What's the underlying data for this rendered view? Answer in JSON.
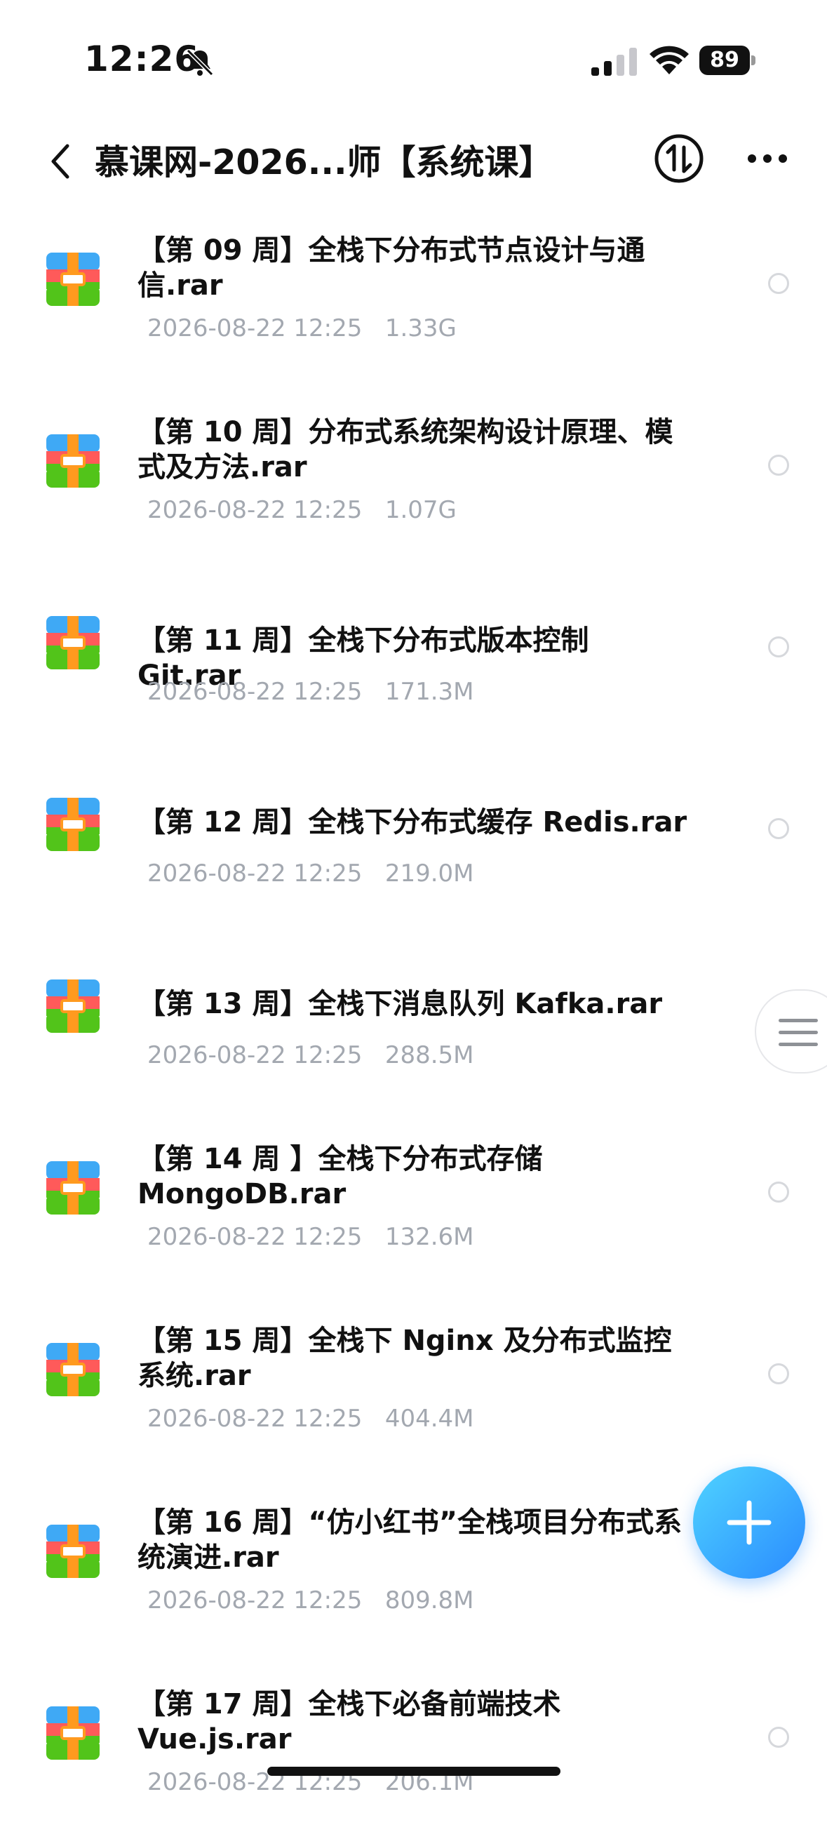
{
  "status_bar": {
    "time": "12:26",
    "battery": "89"
  },
  "nav": {
    "title": "慕课网-2026...师【系统课】"
  },
  "files": [
    {
      "name": "【第 09 周】全栈下分布式节点设计与通信.rar",
      "date": "2026-08-22 12:25",
      "size": "1.33G"
    },
    {
      "name": "【第 10 周】分布式系统架构设计原理、模式及方法.rar",
      "date": "2026-08-22 12:25",
      "size": "1.07G"
    },
    {
      "name": "【第 11 周】全栈下分布式版本控制 Git.rar",
      "date": "2026-08-22 12:25",
      "size": "171.3M"
    },
    {
      "name": "【第 12 周】全栈下分布式缓存 Redis.rar",
      "date": "2026-08-22 12:25",
      "size": "219.0M"
    },
    {
      "name": "【第 13 周】全栈下消息队列 Kafka.rar",
      "date": "2026-08-22 12:25",
      "size": "288.5M"
    },
    {
      "name": "【第 14 周 】全栈下分布式存储 MongoDB.rar",
      "date": "2026-08-22 12:25",
      "size": "132.6M"
    },
    {
      "name": "【第 15 周】全栈下 Nginx 及分布式监控系统.rar",
      "date": "2026-08-22 12:25",
      "size": "404.4M"
    },
    {
      "name": "【第 16 周】“仿小红书”全栈项目分布式系统演进.rar",
      "date": "2026-08-22 12:25",
      "size": "809.8M"
    },
    {
      "name": "【第 17 周】全栈下必备前端技术 Vue.js.rar",
      "date": "2026-08-22 12:25",
      "size": "206.1M"
    }
  ],
  "icons": {
    "file_type": "archive-rar-icon",
    "fab": "plus-icon",
    "nav_right": [
      "transfer-icon",
      "more-icon"
    ]
  },
  "colors": {
    "accent": "#2a8bff",
    "meta_text": "#a3a8b0"
  }
}
